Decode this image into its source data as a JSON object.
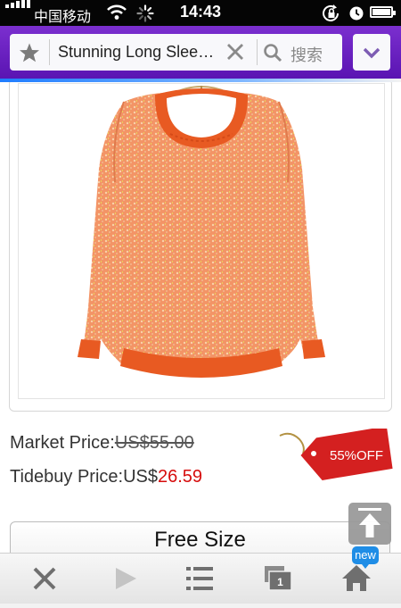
{
  "status_bar": {
    "carrier": "中国移动",
    "time": "14:43"
  },
  "toolbar": {
    "page_title": "Stunning Long Slee…",
    "search_label": "搜索",
    "accent_color": "#6a20c0"
  },
  "product": {
    "image_alt": "Orange knit long sleeve sweater",
    "market_price_label": "Market Price:",
    "market_price_value": "US$55.00",
    "tidebuy_price_label": "Tidebuy Price:",
    "tidebuy_price_currency": "US$",
    "tidebuy_price_value": "26.59",
    "discount_tag": "55%OFF",
    "size_option": "Free Size"
  },
  "bottom_bar": {
    "new_badge": "new",
    "tab_count": "1",
    "icons": [
      "close-icon",
      "play-icon",
      "menu-icon",
      "tabs-icon",
      "home-icon"
    ]
  },
  "colors": {
    "price_red": "#d60c0c",
    "tag_red": "#d42020",
    "sweater_orange": "#f07a45"
  }
}
